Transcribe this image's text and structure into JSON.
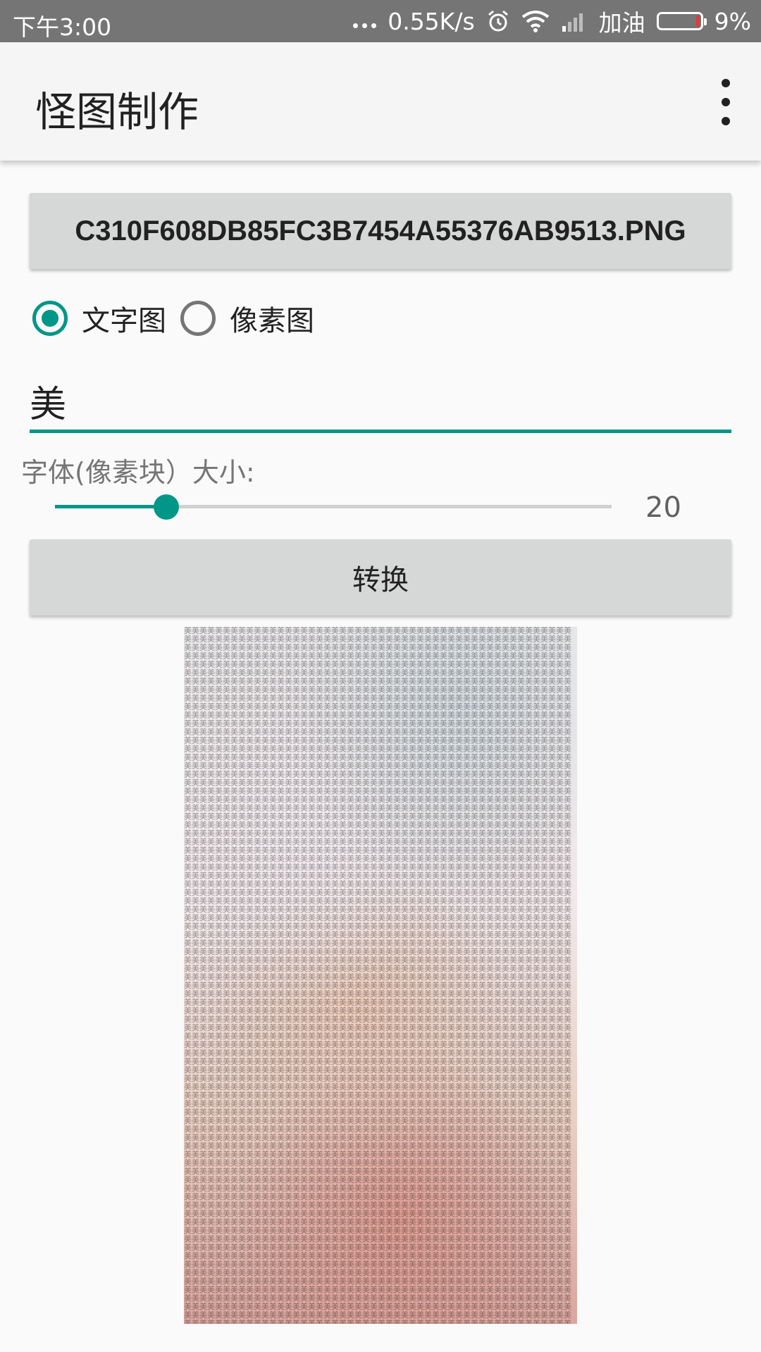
{
  "status_bar": {
    "time": "下午3:00",
    "network_speed": "0.55K/s",
    "carrier": "加油",
    "battery": "9%",
    "battery_level": 0.09,
    "icons": [
      "dots-icon",
      "alarm-icon",
      "wifi-icon",
      "signal-icon",
      "battery-icon"
    ]
  },
  "app_bar": {
    "title": "怪图制作",
    "menu_icon": "more-vertical-icon"
  },
  "file_button": {
    "label": "C310F608DB85FC3B7454A55376AB9513.PNG"
  },
  "mode": {
    "options": [
      {
        "label": "文字图",
        "checked": true
      },
      {
        "label": "像素图",
        "checked": false
      }
    ]
  },
  "text_input": {
    "value": "美"
  },
  "size": {
    "label": "字体(像素块）大小:",
    "value": "20",
    "fraction": 0.2
  },
  "convert_button": {
    "label": "转换"
  },
  "colors": {
    "accent": "#009688",
    "status_bar": "#757575",
    "app_bar": "#f5f5f5",
    "button": "#d6d7d7"
  }
}
